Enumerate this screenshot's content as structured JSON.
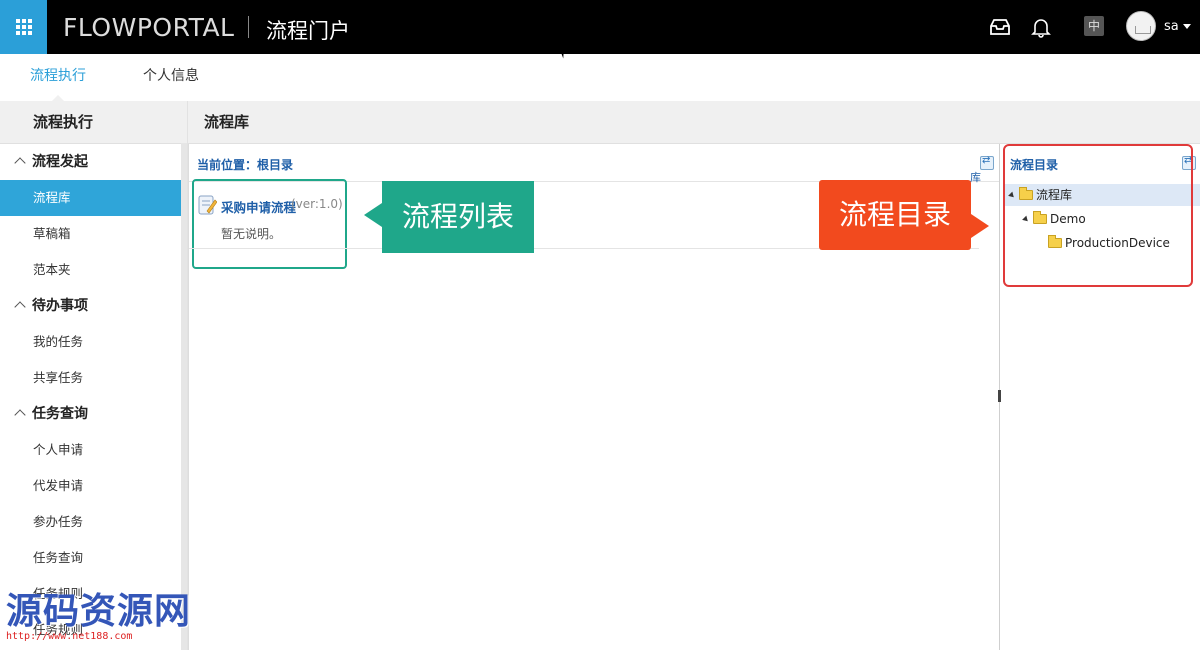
{
  "header": {
    "logo": "FLOWPORTAL",
    "portal_title": "流程门户",
    "language": "中",
    "user": "sa"
  },
  "tabs": [
    {
      "label": "流程执行",
      "active": true
    },
    {
      "label": "个人信息",
      "active": false
    }
  ],
  "sidebar": {
    "title": "流程执行",
    "groups": [
      {
        "label": "流程发起",
        "items": [
          "流程库",
          "草稿箱",
          "范本夹"
        ]
      },
      {
        "label": "待办事项",
        "items": [
          "我的任务",
          "共享任务"
        ]
      },
      {
        "label": "任务查询",
        "items": [
          "个人申请",
          "代发申请",
          "参办任务",
          "任务查询",
          "任务规则",
          "任务规则"
        ]
      }
    ],
    "active_item": "流程库"
  },
  "main": {
    "title": "流程库",
    "breadcrumb": "当前位置：根目录",
    "edge_link": "库",
    "process": {
      "name": "采购申请流程",
      "version": "(ver:1.0)",
      "description": "暂无说明。"
    }
  },
  "tree": {
    "title": "流程目录",
    "nodes": [
      {
        "label": "流程库",
        "selected": true
      },
      {
        "label": "Demo",
        "selected": false
      },
      {
        "label": "ProductionDevice",
        "selected": false
      }
    ]
  },
  "annotations": {
    "list_callout": "流程列表",
    "dir_callout": "流程目录"
  },
  "watermark": {
    "title": "源码资源网",
    "url": "http://www.net188.com"
  },
  "colors": {
    "accent": "#2b9fd8",
    "list_callout": "#1fa78a",
    "dir_callout": "#f24a1e"
  }
}
